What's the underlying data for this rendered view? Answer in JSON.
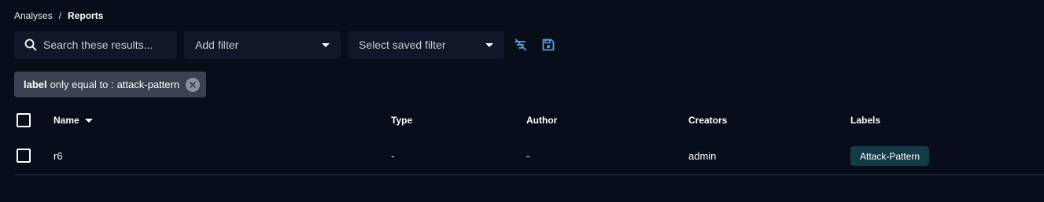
{
  "breadcrumb": {
    "parent": "Analyses",
    "separator": "/",
    "current": "Reports"
  },
  "toolbar": {
    "search_placeholder": "Search these results...",
    "add_filter_label": "Add filter",
    "saved_filter_label": "Select saved filter",
    "clear_filters_icon": "filter-off-icon",
    "save_filter_icon": "save-icon"
  },
  "active_filter": {
    "key": "label",
    "operator": "only equal to :",
    "value": "attack-pattern"
  },
  "table": {
    "columns": {
      "name": "Name",
      "type": "Type",
      "author": "Author",
      "creators": "Creators",
      "labels": "Labels"
    },
    "sort": {
      "column": "Name",
      "direction": "descending"
    },
    "rows": [
      {
        "name": "r6",
        "type": "-",
        "author": "-",
        "creators": "admin",
        "labels": [
          "Attack-Pattern"
        ]
      }
    ]
  },
  "colors": {
    "background": "#070d19",
    "input_background": "#0f1729",
    "chip_background": "#3a4150",
    "accent_blue": "#4fa3e0",
    "label_badge": "#143c47"
  }
}
